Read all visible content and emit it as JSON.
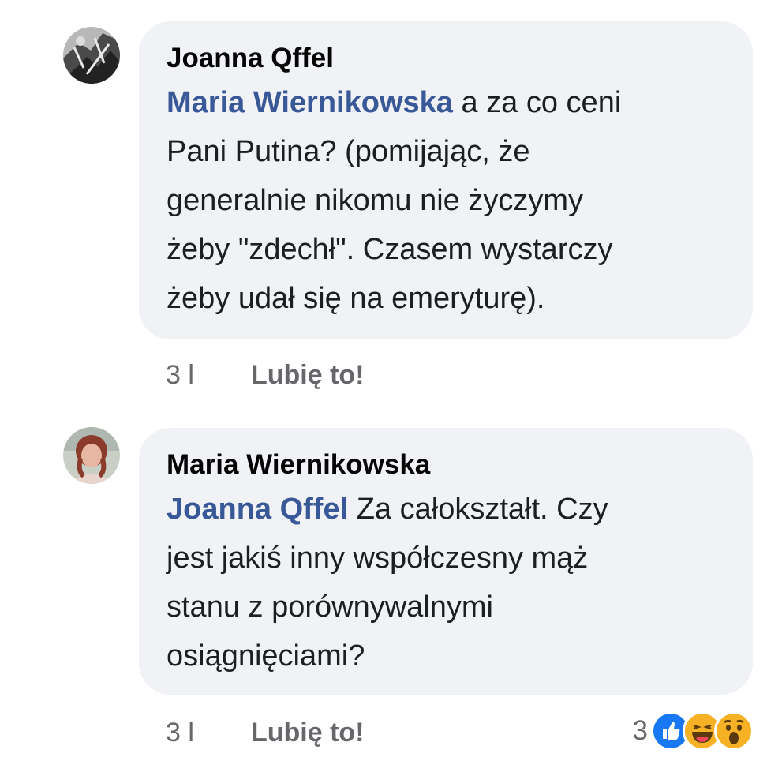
{
  "comments": [
    {
      "author": "Joanna Qffel",
      "mention": "Maria Wiernikowska",
      "text_lines": [
        "a za co ceni",
        "Pani Putina? (pomijając, że",
        "generalnie nikomu nie życzymy",
        "żeby \"zdechł\". Czasem wystarczy",
        "żeby udał się na emeryturę)."
      ],
      "time": "3 l",
      "like_label": "Lubię to!"
    },
    {
      "author": "Maria Wiernikowska",
      "mention": "Joanna Qffel",
      "text_lines": [
        "Za całokształt. Czy",
        "jest jakiś inny współczesny mąż",
        "stanu z porównywalnymi",
        "osiągnięciami?"
      ],
      "time": "3 l",
      "like_label": "Lubię to!",
      "reaction_count": "3",
      "reactions": [
        "like-icon",
        "haha-icon",
        "wow-icon"
      ]
    }
  ],
  "colors": {
    "bubble": "#f0f2f5",
    "mention": "#385898",
    "meta": "#65676b",
    "like_blue": "#1877f2",
    "emoji_yellow": "#f7b125"
  }
}
